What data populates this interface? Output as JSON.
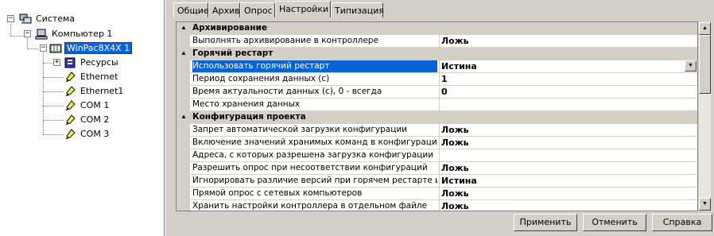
{
  "tree": {
    "nodes": [
      {
        "label": "Система",
        "icon": "network-computers-icon"
      },
      {
        "label": "Компьютер 1",
        "icon": "computer-icon"
      },
      {
        "label": "WinPac8X4X 1",
        "icon": "controller-icon"
      },
      {
        "label": "Ресурсы",
        "icon": "resources-icon"
      },
      {
        "label": "Ethernet",
        "icon": "port-plug-icon"
      },
      {
        "label": "Ethernet1",
        "icon": "port-plug-icon"
      },
      {
        "label": "COM 1",
        "icon": "port-plug-icon"
      },
      {
        "label": "COM 2",
        "icon": "port-plug-icon"
      },
      {
        "label": "COM 3",
        "icon": "port-plug-icon"
      }
    ]
  },
  "tabs": [
    "Общие",
    "Архив",
    "Опрос",
    "Настройки",
    "Типизация"
  ],
  "active_tab": "Настройки",
  "grid": {
    "rows": [
      {
        "type": "cat",
        "name": "Архивирование"
      },
      {
        "type": "prop",
        "name": "Выполнять архивирование в контроллере",
        "value": "Ложь"
      },
      {
        "type": "cat",
        "name": "Горячий рестарт"
      },
      {
        "type": "prop",
        "name": "Использовать горячий рестарт",
        "value": "Истина",
        "selected": true
      },
      {
        "type": "prop",
        "name": "Период сохранения данных (с)",
        "value": "1"
      },
      {
        "type": "prop",
        "name": "Время актуальности данных (с), 0 - всегда",
        "value": "0"
      },
      {
        "type": "prop",
        "name": "Место хранения данных",
        "value": ""
      },
      {
        "type": "cat",
        "name": "Конфигурация проекта"
      },
      {
        "type": "prop",
        "name": "Запрет автоматической загрузки конфигурации",
        "value": "Ложь"
      },
      {
        "type": "prop",
        "name": "Включение значений хранимых команд в конфигурацию",
        "value": "Ложь"
      },
      {
        "type": "prop",
        "name": "Адреса, с которых разрешена загрузка конфигурации",
        "value": ""
      },
      {
        "type": "prop",
        "name": "Разрешить опрос при несоответствии конфигураций",
        "value": "Ложь"
      },
      {
        "type": "prop",
        "name": "Игнорировать различие версий при горячем рестарте или р",
        "value": "Истина"
      },
      {
        "type": "prop",
        "name": "Прямой опрос с сетевых компьютеров",
        "value": "Ложь"
      },
      {
        "type": "prop",
        "name": "Хранить настройки контроллера в отдельном файле",
        "value": "Ложь"
      }
    ]
  },
  "buttons": {
    "apply": "Применить",
    "cancel": "Отменить",
    "help": "Справка"
  },
  "colors": {
    "selection": "#0a64d8",
    "face": "#d4d0c8"
  }
}
